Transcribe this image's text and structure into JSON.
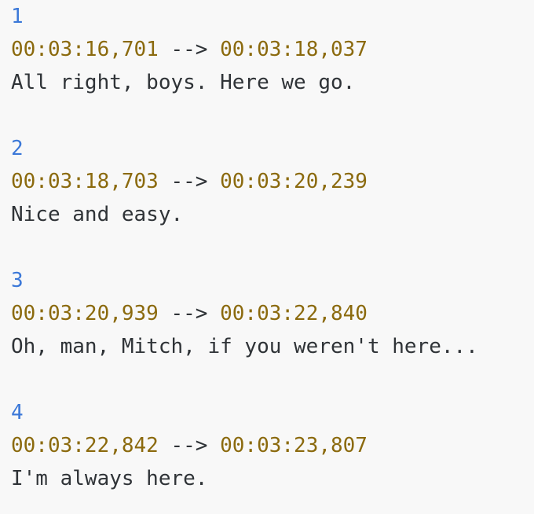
{
  "cues": [
    {
      "index": "1",
      "start": "00:03:16,701",
      "arrow": " --> ",
      "end": "00:03:18,037",
      "text": "All right, boys. Here we go."
    },
    {
      "index": "2",
      "start": "00:03:18,703",
      "arrow": " --> ",
      "end": "00:03:20,239",
      "text": "Nice and easy."
    },
    {
      "index": "3",
      "start": "00:03:20,939",
      "arrow": " --> ",
      "end": "00:03:22,840",
      "text": "Oh, man, Mitch, if you weren't here..."
    },
    {
      "index": "4",
      "start": "00:03:22,842",
      "arrow": " --> ",
      "end": "00:03:23,807",
      "text": "I'm always here."
    }
  ],
  "colors": {
    "background": "#f8f8f8",
    "index": "#3b78d8",
    "timecode": "#8b6a0e",
    "text": "#2f3337"
  }
}
